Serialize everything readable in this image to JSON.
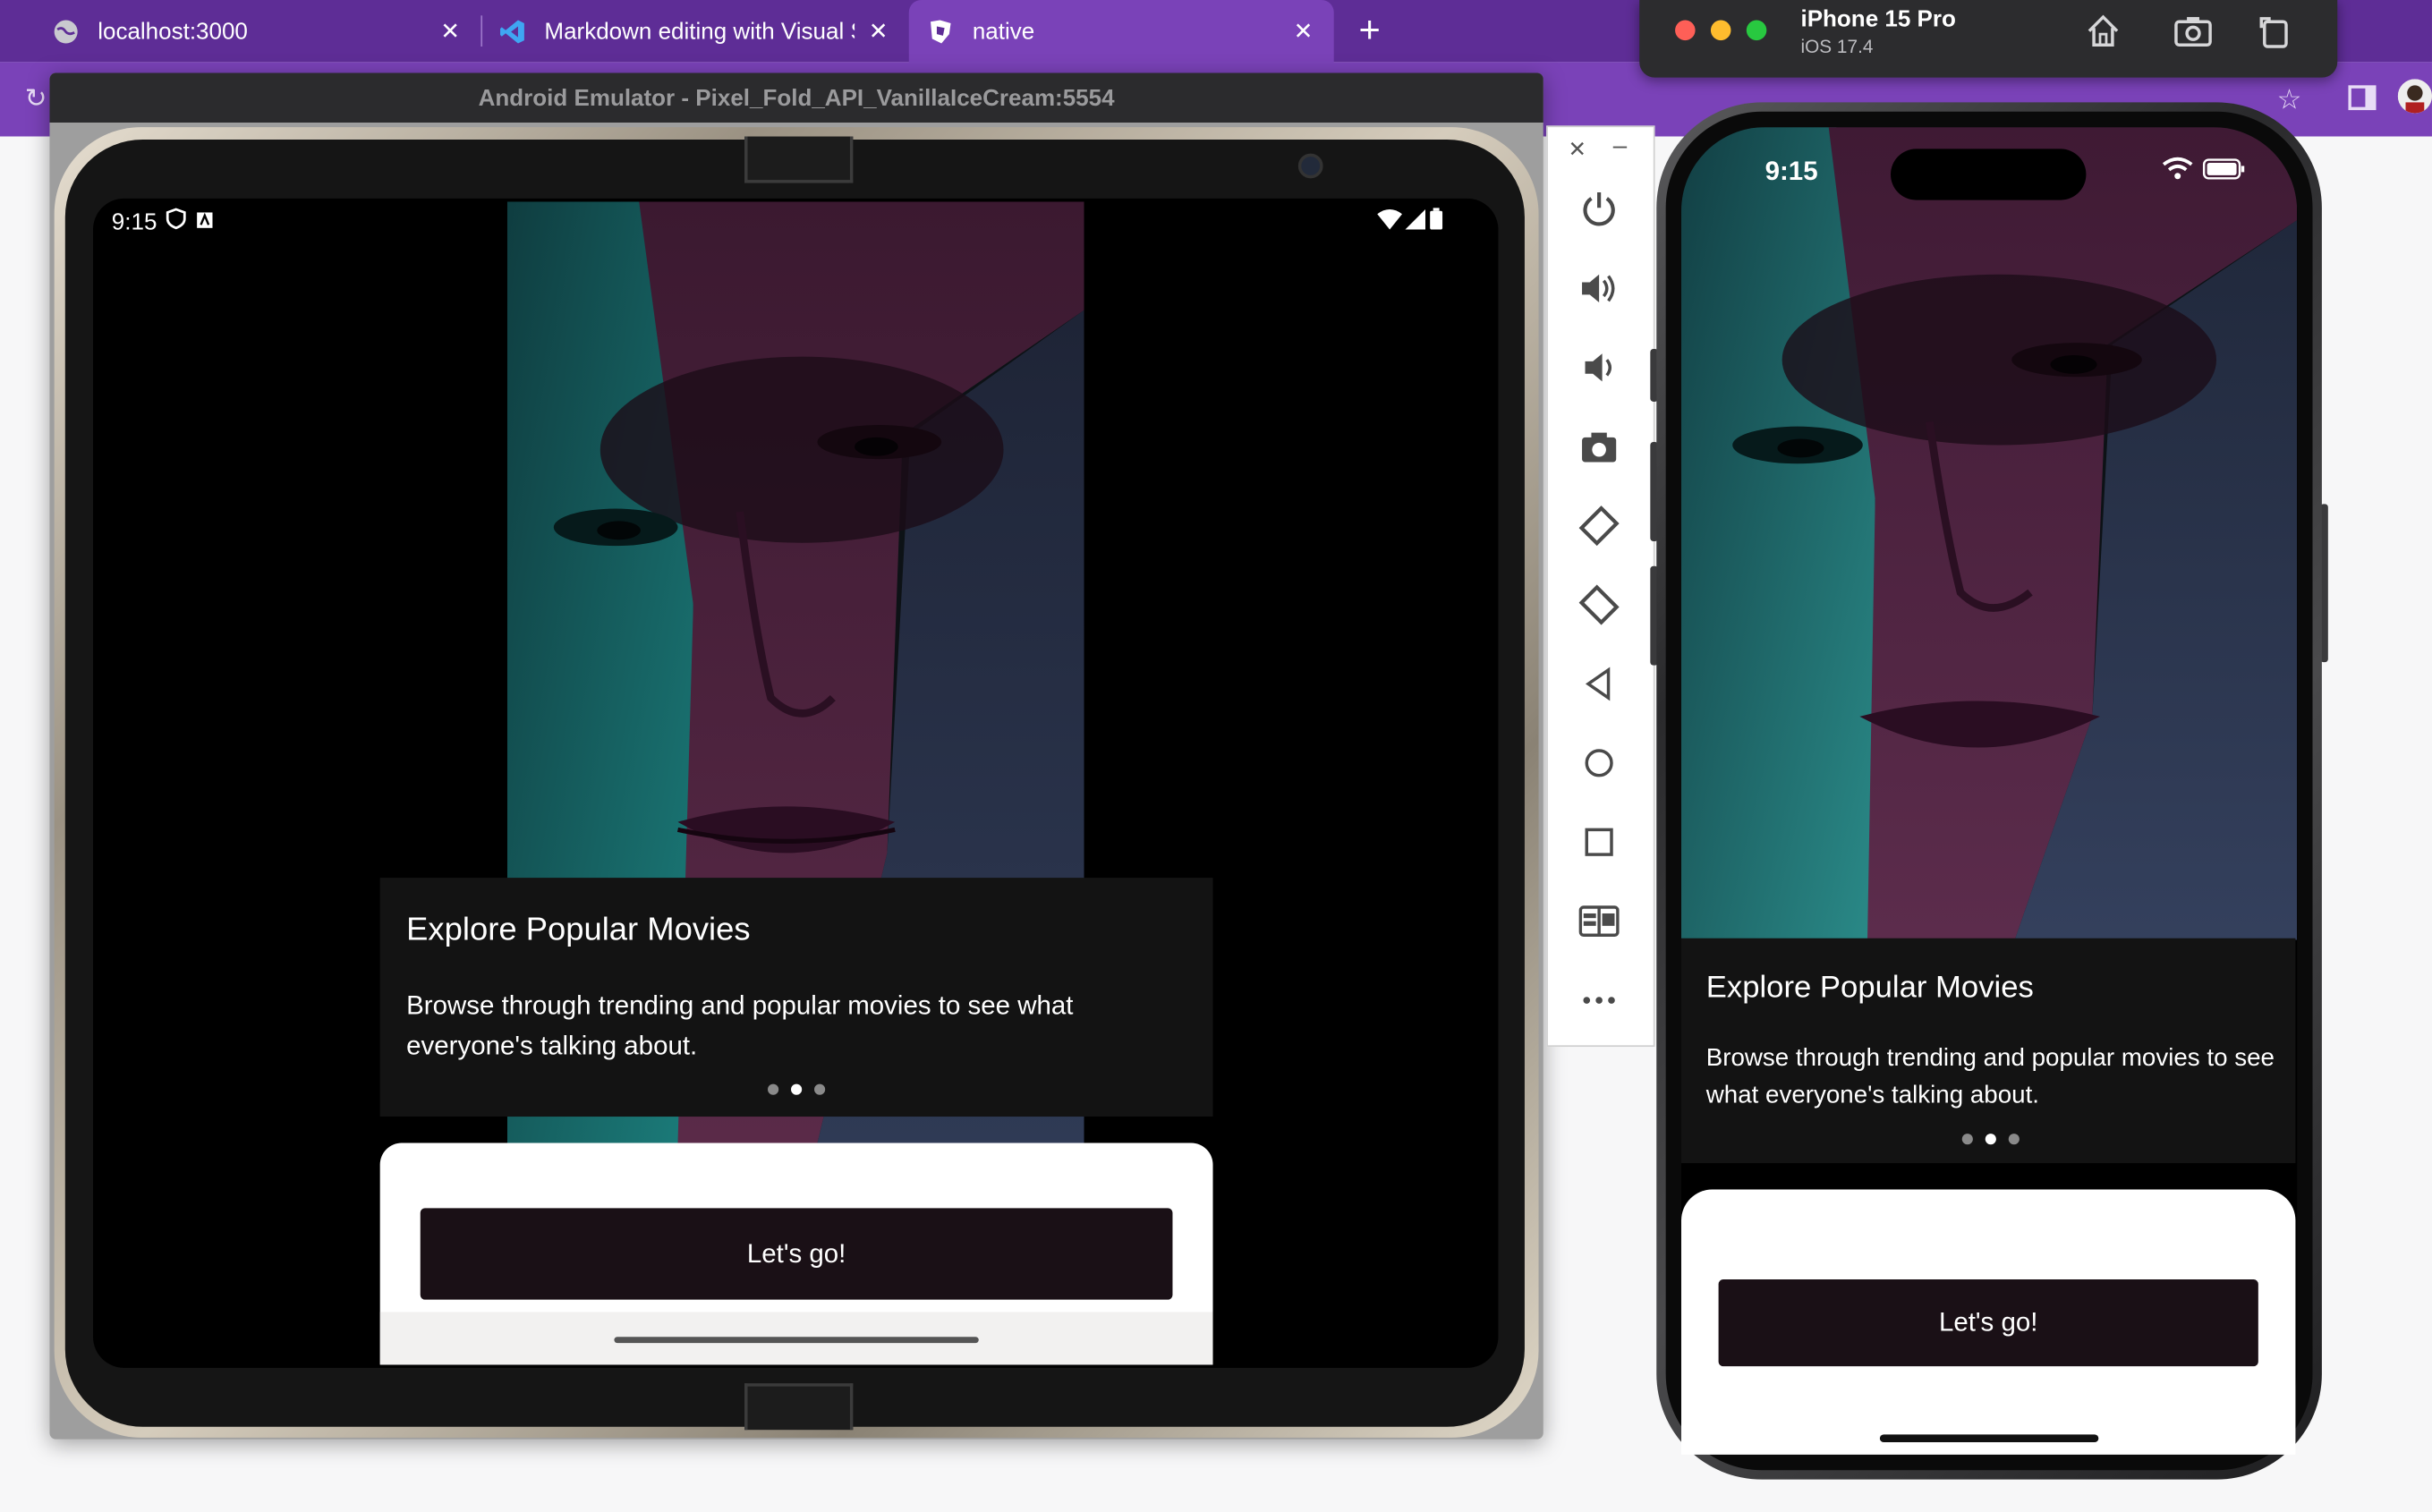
{
  "browser": {
    "tabs": [
      {
        "title": "localhost:3000",
        "icon": "globe-icon"
      },
      {
        "title": "Markdown editing with Visual S",
        "icon": "vscode-icon"
      },
      {
        "title": "native",
        "icon": "expo-icon"
      }
    ],
    "active_tab": 2,
    "colors": {
      "tabbar": "#5e2d96",
      "addressbar": "#7a42b8"
    }
  },
  "ios_simulator": {
    "device": "iPhone 15 Pro",
    "os": "iOS 17.4",
    "time": "9:15"
  },
  "android_emulator": {
    "window_title": "Android Emulator - Pixel_Fold_API_VanillaIceCream:5554",
    "time": "9:15",
    "toolbar": [
      "power-icon",
      "volume-up-icon",
      "volume-down-icon",
      "camera-icon",
      "rotate-left-icon",
      "rotate-right-icon",
      "back-icon",
      "home-icon",
      "overview-icon",
      "fold-icon",
      "more-icon"
    ]
  },
  "app": {
    "slide_title": "Explore Popular Movies",
    "slide_body": "Browse through trending and popular movies to see what everyone's talking about.",
    "slide_count": 3,
    "active_slide": 1,
    "cta_label": "Let's go!",
    "colors": {
      "button": "#1a1016",
      "card": "#131313"
    }
  }
}
